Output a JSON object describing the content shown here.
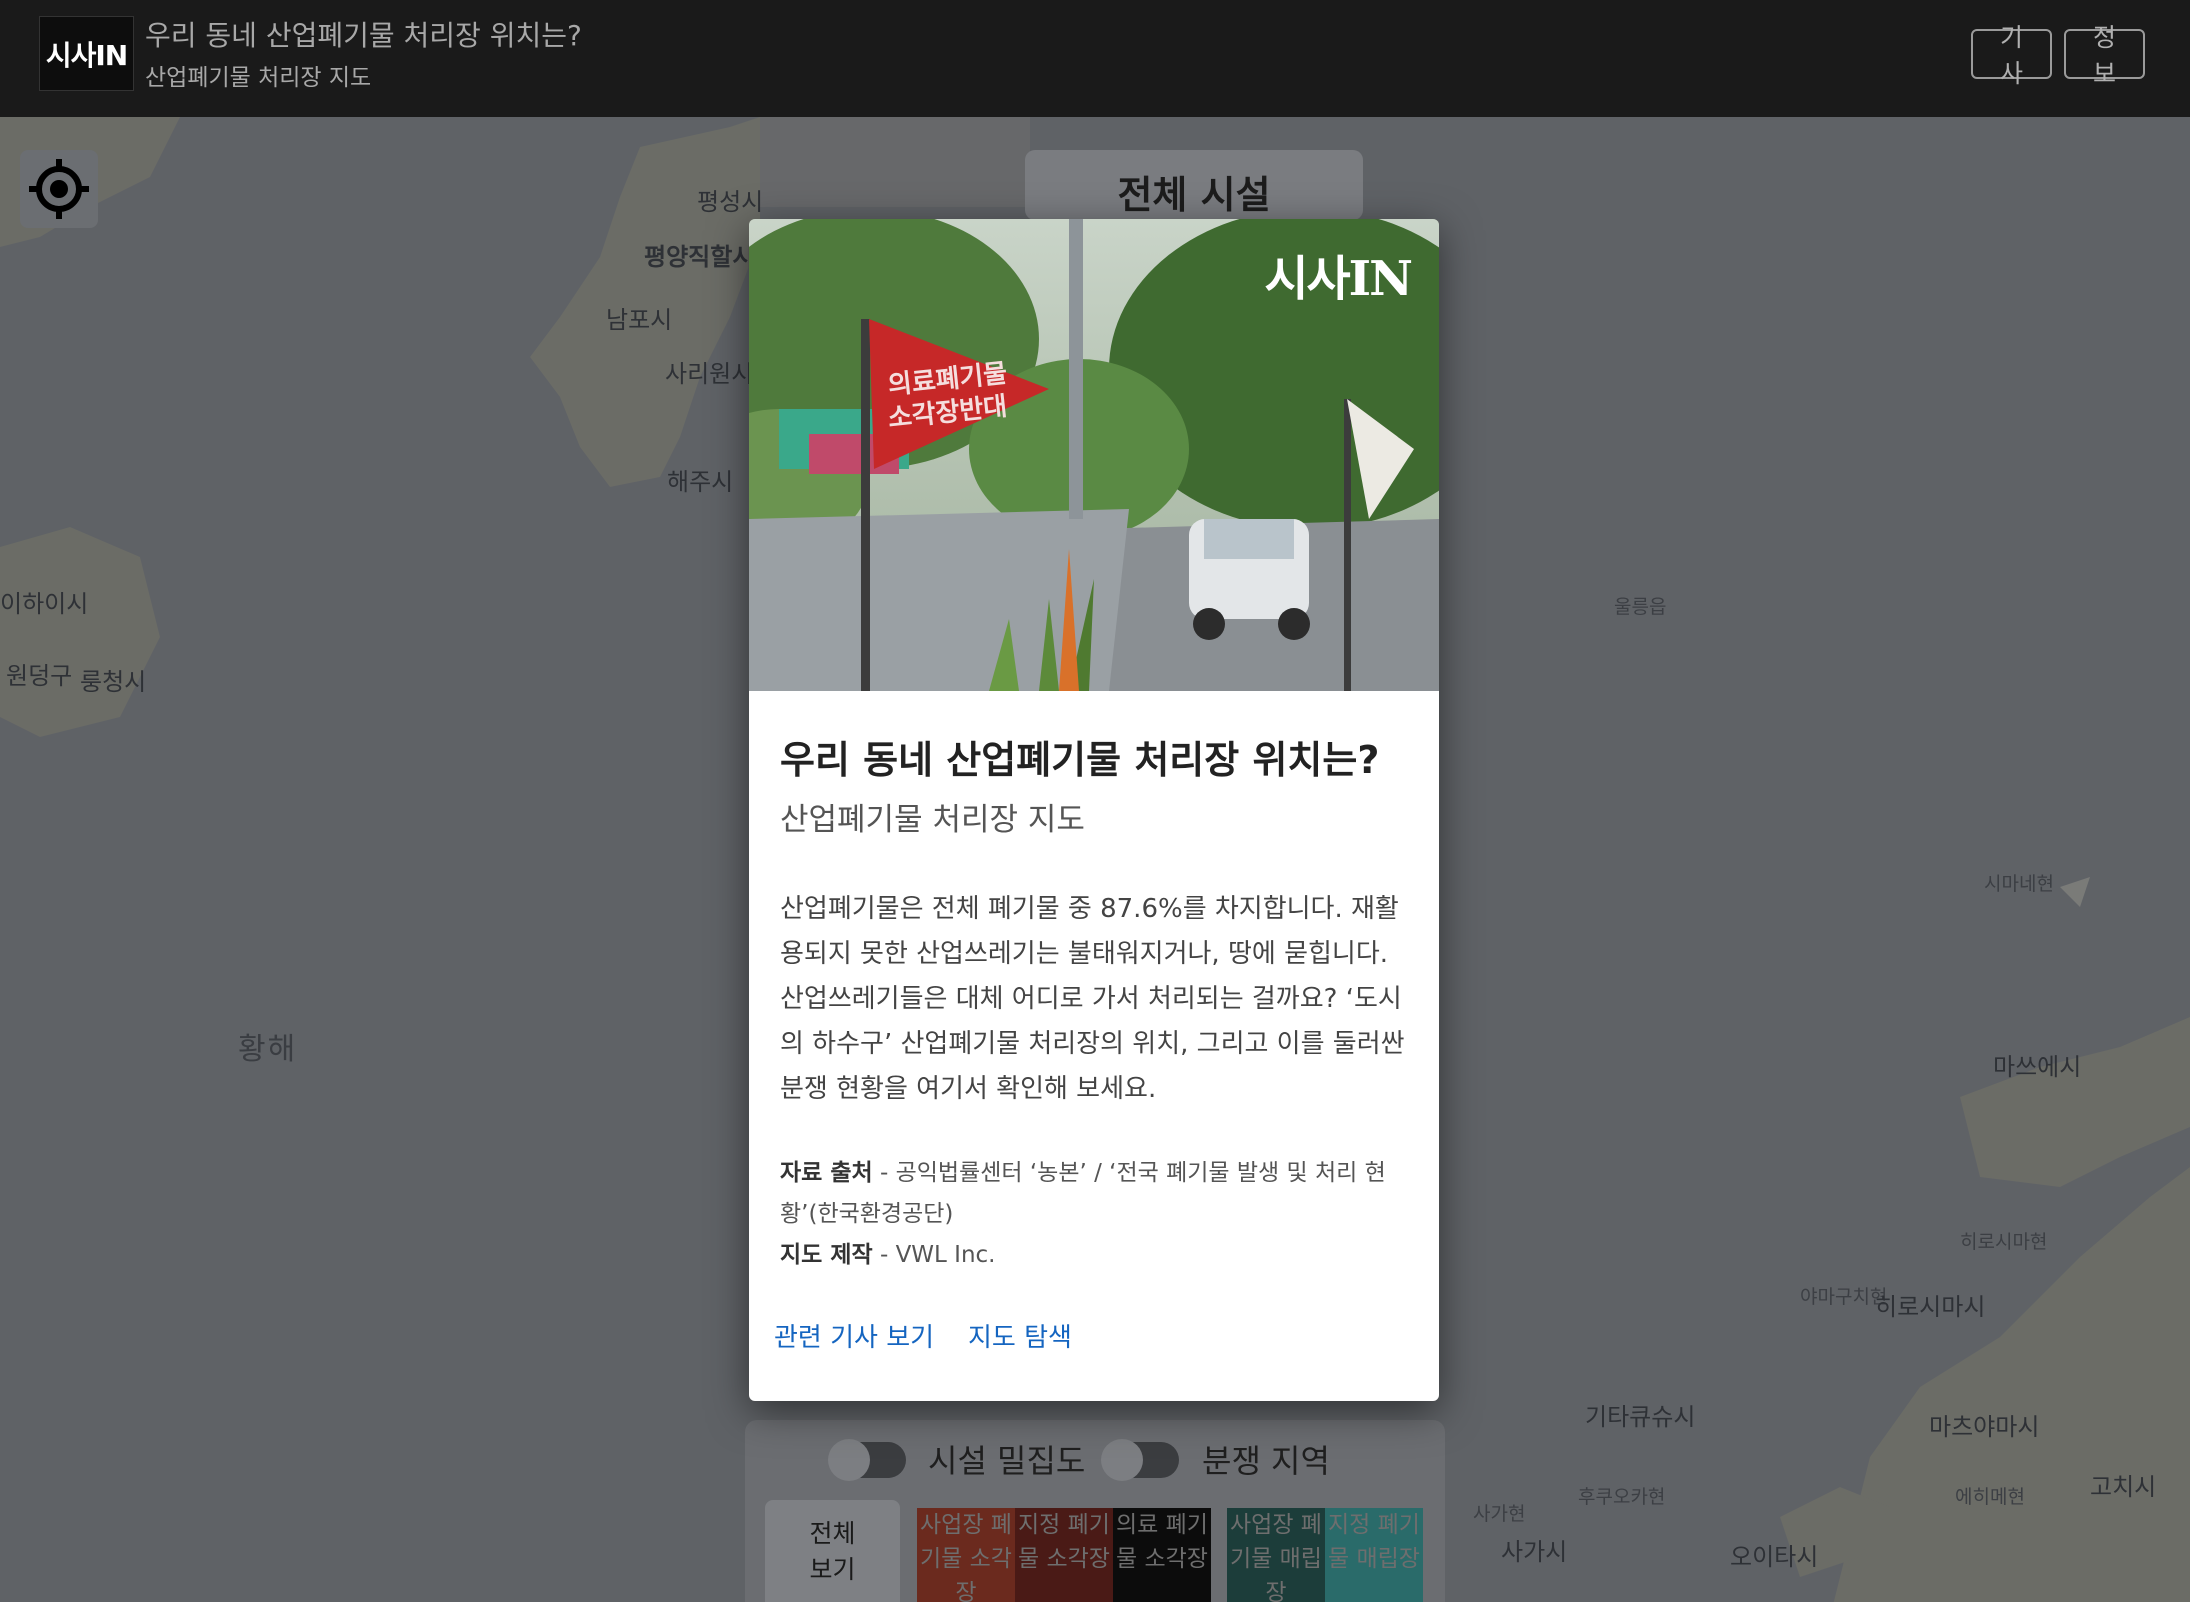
{
  "header": {
    "logo_text": "시사IN",
    "title": "우리 동네 산업폐기물 처리장 위치는?",
    "subtitle": "산업폐기물 처리장 지도",
    "article_button": "기사",
    "info_button": "정보"
  },
  "map": {
    "labels": {
      "pyeongseong": "평성시",
      "pyongyang": "평양직할시",
      "nampo": "남포시",
      "sariwon": "사리원시",
      "haeju": "해주시",
      "weihai": "이하이시",
      "wendeng": "원덩구",
      "rongcheng": "룽청시",
      "yellow_sea": "황해",
      "ulleung": "울릉읍",
      "shimane": "시마네현",
      "matsue": "마쓰에시",
      "yamaguchi_pref": "야마구치현",
      "hiroshima_pref": "히로시마현",
      "hiroshima": "히로시마시",
      "kitakyushu": "기타큐슈시",
      "fukuoka_pref": "후쿠오카현",
      "matsuyama": "마츠야마시",
      "ehime": "에히메현",
      "kochi": "고치시",
      "saga_pref": "사가현",
      "saga": "사가시",
      "oita": "오이타시"
    }
  },
  "facility_panel": {
    "title": "전체 시설"
  },
  "controls": {
    "density_label": "시설 밀집도",
    "conflict_label": "분쟁 지역",
    "all_button": "전체 보기",
    "categories": [
      {
        "label": "사업장 폐기물 소각장",
        "color": "#6b2a1e"
      },
      {
        "label": "지정 폐기물 소각장",
        "color": "#4a1a16"
      },
      {
        "label": "의료 폐기물 소각장",
        "color": "#0c0c0c"
      },
      {
        "label": "사업장 폐기물 매립장",
        "color": "#1c3d3a"
      },
      {
        "label": "지정 폐기물 매립장",
        "color": "#2a6b6a"
      }
    ]
  },
  "modal": {
    "hero_logo": "시사IN",
    "hero_flag_text_1": "의료폐기물",
    "hero_flag_text_2": "소각장반대",
    "title": "우리 동네 산업폐기물 처리장 위치는?",
    "subtitle": "산업폐기물 처리장 지도",
    "description": "산업폐기물은 전체 폐기물 중 87.6%를 차지합니다. 재활용되지 못한 산업쓰레기는 불태워지거나, 땅에 묻힙니다. 산업쓰레기들은 대체 어디로 가서 처리되는 걸까요? ‘도시의 하수구’ 산업폐기물 처리장의 위치, 그리고 이를 둘러싼 분쟁 현황을 여기서 확인해 보세요.",
    "source_label": "자료 출처",
    "source_text": " - 공익법률센터 ‘농본’ / ‘전국 폐기물 발생 및 처리 현황’(한국환경공단)",
    "maker_label": "지도 제작",
    "maker_text": " - VWL Inc.",
    "link_article": "관련 기사 보기",
    "link_explore": "지도 탐색"
  },
  "colors": {
    "header_bg": "#1a1a1a",
    "link": "#1565c0",
    "flag_red": "#c62828"
  }
}
